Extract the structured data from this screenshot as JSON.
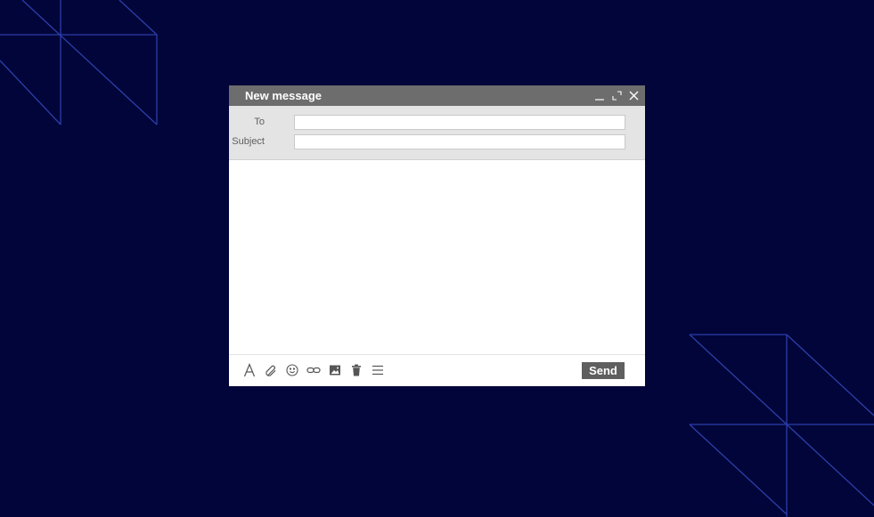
{
  "compose": {
    "title": "New message",
    "controls": {
      "minimize_icon": "minimize-icon",
      "expand_icon": "expand-icon",
      "close_icon": "close-icon"
    },
    "fields": {
      "to_label": "To",
      "to_value": "",
      "subject_label": "Subject",
      "subject_value": ""
    },
    "body_value": "",
    "toolbar": {
      "icons": [
        "text-format-icon",
        "attach-icon",
        "emoji-icon",
        "link-icon",
        "image-icon",
        "delete-icon",
        "more-options-icon"
      ]
    },
    "send_label": "Send"
  },
  "colors": {
    "background": "#02053a",
    "decor_lines": "#2b3fa8",
    "header": "#6d6d6d",
    "fields_bg": "#e4e4e4",
    "send_button": "#5f5f5f"
  }
}
